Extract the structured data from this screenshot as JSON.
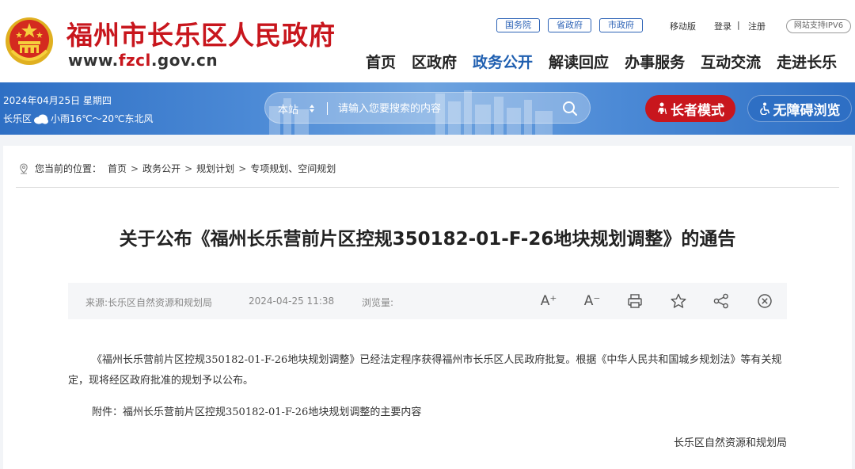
{
  "header": {
    "site_name": "福州市长乐区人民政府",
    "url_prefix": "www.",
    "url_accent": "fzcl",
    "url_suffix": ".gov.cn",
    "gov_links": [
      "国务院",
      "省政府",
      "市政府"
    ],
    "mobile_label": "移动版",
    "login_label": "登录",
    "util_separator": "|",
    "register_label": "注册",
    "ipv6_label": "网站支持IPV6",
    "nav": [
      {
        "label": "首页"
      },
      {
        "label": "区政府"
      },
      {
        "label": "政务公开"
      },
      {
        "label": "解读回应"
      },
      {
        "label": "办事服务"
      },
      {
        "label": "互动交流"
      },
      {
        "label": "走进长乐"
      }
    ],
    "active_nav": "政务公开"
  },
  "band": {
    "date": "2024年04月25日 星期四",
    "weather_area": "长乐区",
    "weather_text": "小雨16℃～20℃东北风",
    "search": {
      "scope": "本站",
      "placeholder": "请输入您要搜索的内容"
    },
    "elder_mode_label": "长者模式",
    "accessibility_label": "无障碍浏览"
  },
  "breadcrumb": {
    "prefix": "您当前的位置：",
    "items": [
      "首页",
      "政务公开",
      "规划计划",
      "专项规划、空间规划"
    ],
    "separator": ">"
  },
  "article": {
    "title": "关于公布《福州长乐营前片区控规350182-01-F-26地块规划调整》的通告",
    "source": "来源:长乐区自然资源和规划局",
    "date": "2024-04-25 11:38",
    "views_label": "浏览量:",
    "paragraph_1": "《福州长乐营前片区控规350182-01-F-26地块规划调整》已经法定程序获得福州市长乐区人民政府批复。根据《中华人民共和国城乡规划法》等有关规定，现将经区政府批准的规划予以公布。",
    "paragraph_2": "附件：福州长乐营前片区控规350182-01-F-26地块规划调整的主要内容",
    "signature": "长乐区自然资源和规划局"
  },
  "tools": {
    "font_increase": "A⁺",
    "font_decrease": "A⁻"
  },
  "colors": {
    "brand_red": "#c8161d",
    "nav_blue": "#1f5fb0",
    "band_blue": "#2e6fc4"
  },
  "icons": [
    "national-emblem-icon",
    "cloud-icon",
    "dropdown-arrows-icon",
    "search-icon",
    "elder-icon",
    "wheelchair-icon",
    "location-pin-icon",
    "print-icon",
    "star-icon",
    "share-icon",
    "close-icon"
  ]
}
